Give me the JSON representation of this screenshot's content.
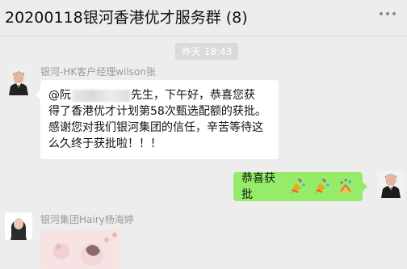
{
  "header": {
    "title": "20200118银河香港优才服务群 (8)"
  },
  "timestamp": "昨天 18:43",
  "messages": [
    {
      "sender": "银河-HK客户经理wilson张",
      "mention": "@阮",
      "text_line1_tail": "先生，下午好，恭喜您获",
      "text_line2": "得了香港优才计划第58次甄选配额的获批。",
      "text_line3": "感谢您对我们银河集团的信任，辛苦等待这",
      "text_line4": "么久终于获批啦！！！"
    },
    {
      "self": true,
      "text": "恭喜获批",
      "emoji": [
        "party-popper-icon",
        "party-popper-icon",
        "celebration-icon"
      ]
    },
    {
      "sender": "银河集团Hairy杨海婷",
      "type": "image"
    }
  ]
}
